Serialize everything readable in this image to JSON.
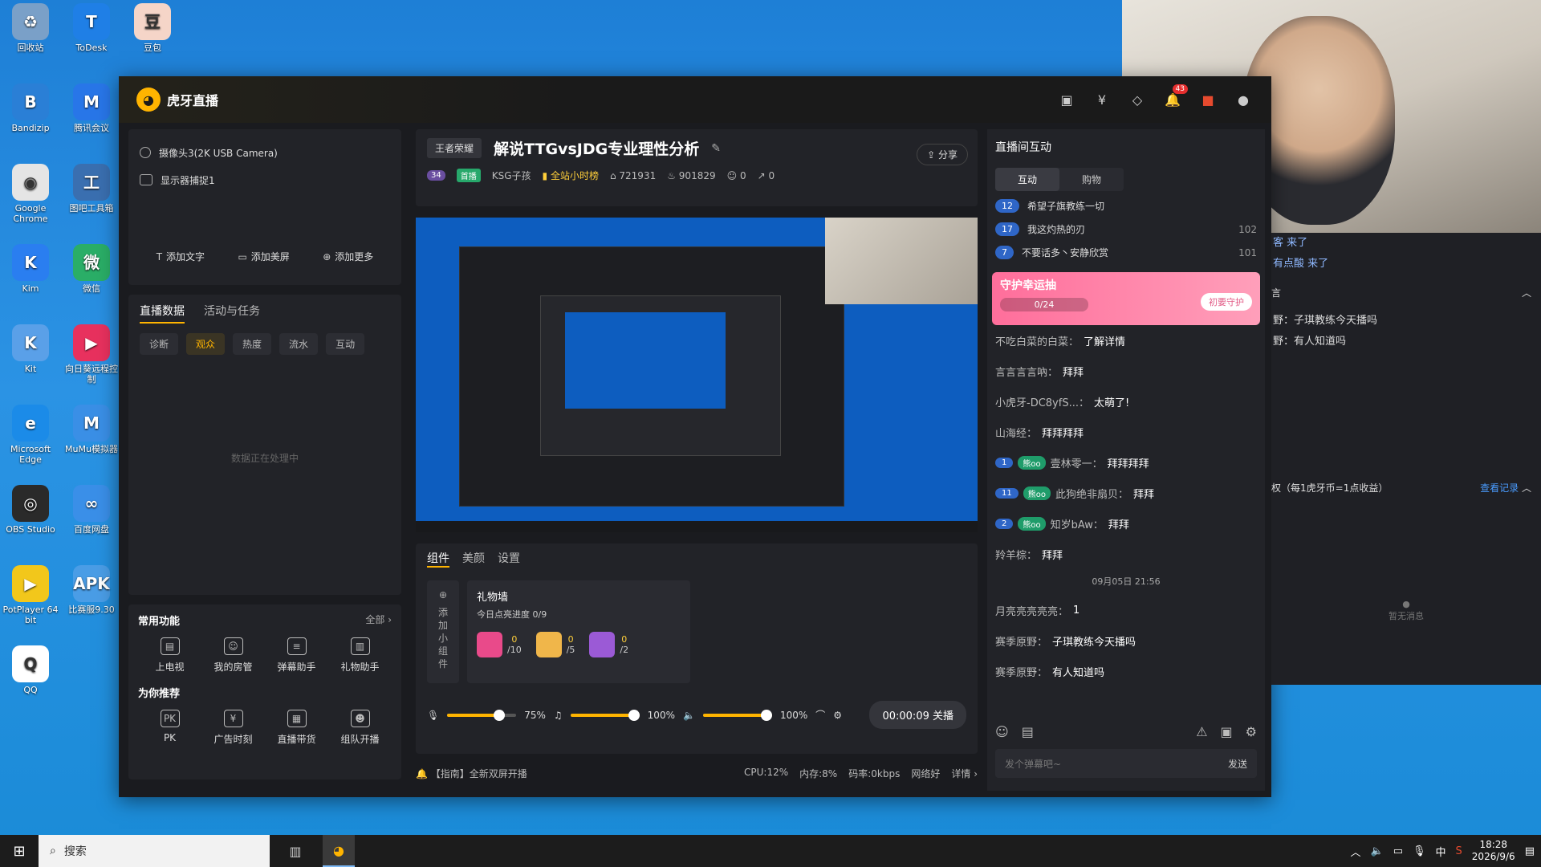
{
  "desktop": {
    "icons": [
      {
        "label": "回收站",
        "color": "#7aa0c8",
        "glyph": "♻"
      },
      {
        "label": "ToDesk",
        "color": "#1f7fe6",
        "glyph": "T"
      },
      {
        "label": "豆包",
        "color": "#f5d5c8",
        "glyph": "豆"
      },
      {
        "label": "Bandizip",
        "color": "#2a7fd6",
        "glyph": "B"
      },
      {
        "label": "腾讯会议",
        "color": "#2876e8",
        "glyph": "M"
      },
      {
        "label": "Google Chrome",
        "color": "#e5e5e5",
        "glyph": "◉"
      },
      {
        "label": "图吧工具箱",
        "color": "#3a6fb0",
        "glyph": "工"
      },
      {
        "label": "Kim",
        "color": "#2a7ef0",
        "glyph": "K"
      },
      {
        "label": "微信",
        "color": "#2aae67",
        "glyph": "微"
      },
      {
        "label": "Kit",
        "color": "#5aa0e8",
        "glyph": "K"
      },
      {
        "label": "向日葵远程控制",
        "color": "#e8315e",
        "glyph": "▶"
      },
      {
        "label": "Microsoft Edge",
        "color": "#1b8be8",
        "glyph": "e"
      },
      {
        "label": "MuMu模拟器",
        "color": "#3a8fe6",
        "glyph": "M"
      },
      {
        "label": "OBS Studio",
        "color": "#2a2a2a",
        "glyph": "◎"
      },
      {
        "label": "百度网盘",
        "color": "#3a8fe8",
        "glyph": "∞"
      },
      {
        "label": "PotPlayer 64 bit",
        "color": "#f2c71b",
        "glyph": "▶"
      },
      {
        "label": "比赛服9.30",
        "color": "#4a9de6",
        "glyph": "APK"
      },
      {
        "label": "QQ",
        "color": "#ffffff",
        "glyph": "Q"
      }
    ]
  },
  "app": {
    "name": "虎牙直播",
    "notification_count": "43",
    "sources": [
      "摄像头3(2K USB Camera)",
      "显示器捕捉1"
    ],
    "add_actions": [
      "添加文字",
      "添加美屏",
      "添加更多"
    ],
    "data_tabs": [
      "直播数据",
      "活动与任务"
    ],
    "data_chips": [
      "诊断",
      "观众",
      "热度",
      "流水",
      "互动"
    ],
    "processing_text": "数据正在处理中",
    "common_title": "常用功能",
    "common_all": "全部",
    "common_items": [
      "上电视",
      "我的房管",
      "弹幕助手",
      "礼物助手"
    ],
    "recommend_title": "为你推荐",
    "recommend_items": [
      "PK",
      "广告时刻",
      "直播带货",
      "组队开播"
    ],
    "category_tag": "王者荣耀",
    "live_title": "解说TTGvsJDG专业理性分析",
    "share_label": "分享",
    "stats": {
      "level": "34",
      "badge": "首播",
      "guild": "KSG子孩",
      "rank": "全站小时榜",
      "viewers": "721931",
      "heat": "901829",
      "subs": "0",
      "shares": "0"
    },
    "ctrl_tabs": [
      "组件",
      "美颜",
      "设置"
    ],
    "add_widget": "添加小组件",
    "gift_wall": {
      "title": "礼物墙",
      "subtitle": "今日点亮进度 0/9",
      "gifts": [
        {
          "count": "0",
          "total": "/10",
          "color": "#e94a8a"
        },
        {
          "count": "0",
          "total": "/5",
          "color": "#f0b64a"
        },
        {
          "count": "0",
          "total": "/2",
          "color": "#9b5ad6"
        }
      ]
    },
    "audio": {
      "mic": "75%",
      "music": "100%",
      "speaker": "100%"
    },
    "timer_label": "00:00:09 关播",
    "footer_tip": "【指南】全新双屏开播",
    "footer_stats": [
      "CPU:12%",
      "内存:8%",
      "码率:0kbps",
      "网络好",
      "详情"
    ]
  },
  "chat": {
    "title": "直播间互动",
    "tabs": [
      "互动",
      "购物"
    ],
    "ranks": [
      {
        "lv": "12",
        "text": "希望子旗教练一切",
        "score": ""
      },
      {
        "lv": "17",
        "text": "我这灼热的刃",
        "score": "102"
      },
      {
        "lv": "7",
        "text": "不要话多丶安静欣赏",
        "score": "101"
      }
    ],
    "guard": {
      "title": "守护幸运抽",
      "progress": "0/24",
      "right": "初要守护"
    },
    "messages": [
      {
        "user": "不吃白菜的白菜：",
        "text": "了解详情"
      },
      {
        "user": "言言言言吶：",
        "text": "拜拜"
      },
      {
        "user": "小虎牙-DC8yfS...：",
        "text": "太萌了!"
      },
      {
        "user": "山海经：",
        "text": "拜拜拜拜"
      },
      {
        "lv": "1",
        "fan": "熊oo",
        "user": "壹林零一：",
        "text": "拜拜拜拜"
      },
      {
        "lv": "11",
        "fan": "熊oo",
        "user": "此狗绝非扇贝：",
        "text": "拜拜"
      },
      {
        "lv": "2",
        "fan": "熊oo",
        "user": "知岁bAw：",
        "text": "拜拜"
      },
      {
        "user": "羚羊棕：",
        "text": "拜拜"
      }
    ],
    "timestamp": "09月05日 21:56",
    "messages2": [
      {
        "user": "月亮亮亮亮亮：",
        "text": "1"
      },
      {
        "user": "赛季原野：",
        "text": "子琪教练今天播吗"
      },
      {
        "user": "赛季原野：",
        "text": "有人知道吗"
      }
    ],
    "input_placeholder": "发个弹幕吧~",
    "send_label": "发送"
  },
  "side": {
    "lines": [
      "客 来了",
      "有点酸 来了"
    ],
    "section1": "言",
    "msgs": [
      "野：子琪教练今天播吗",
      "野：有人知道吗"
    ],
    "section2": "权（每1虎牙币=1点收益）",
    "section2_link": "查看记录",
    "empty": "暂无消息"
  },
  "taskbar": {
    "search": "搜索",
    "ime": "中",
    "time": "18:28",
    "date": "2026/9/6"
  }
}
